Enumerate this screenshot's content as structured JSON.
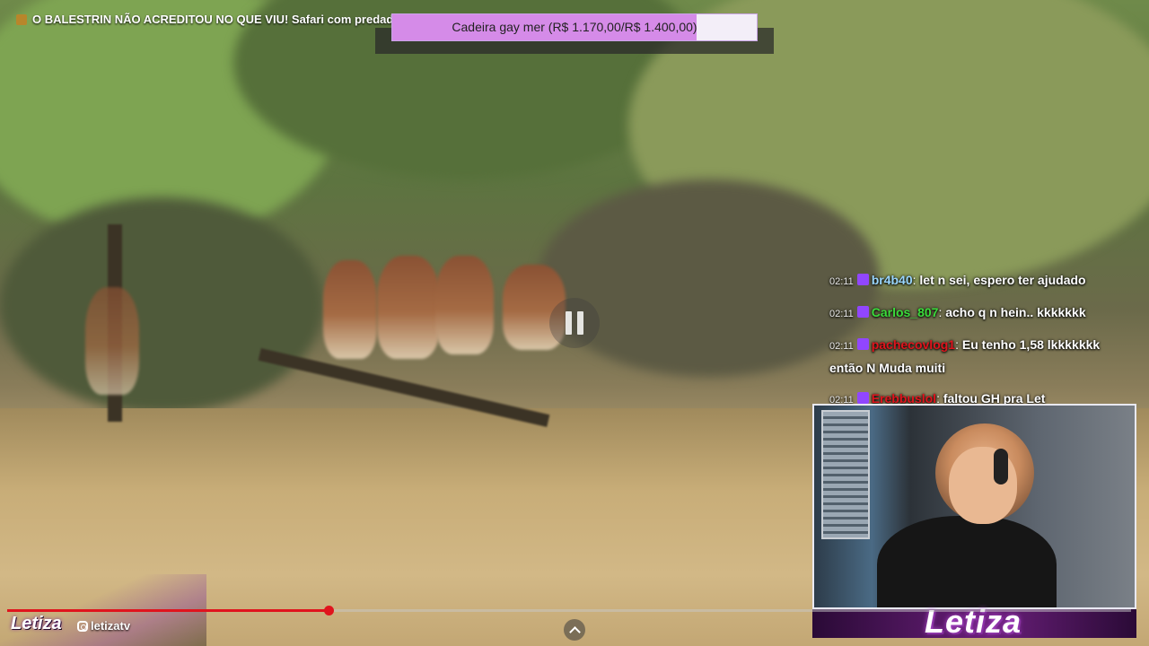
{
  "stream": {
    "title": "O BALESTRIN NÃO ACREDITOU NO QUE VIU! Safari com predadore",
    "progress_percent": 28.6
  },
  "goal": {
    "text": "Cadeira gay mer (R$ 1.170,00/R$ 1.400,00)",
    "current": 1170,
    "target": 1400,
    "fill_color": "#d58be8"
  },
  "chat": {
    "messages": [
      {
        "time": "02:11",
        "user": "br4b40",
        "user_color": "#9ad7ff",
        "text": "let n sei, espero ter ajudado"
      },
      {
        "time": "02:11",
        "user": "Carlos_807",
        "user_color": "#3bdc3b",
        "text": "acho q n hein.. kkkkkkk"
      },
      {
        "time": "02:11",
        "user": "pachecovlog1",
        "user_color": "#e0141d",
        "text": "Eu tenho 1,58 lkkkkkkk então N Muda muiti"
      },
      {
        "time": "02:11",
        "user": "Erebbuslol",
        "user_color": "#e0141d",
        "text": "faltou GH pra Let"
      }
    ]
  },
  "branding": {
    "logo": "Letiza",
    "handle": "letizatv",
    "cam_logo": "Letiza",
    "accent": "#9146ff"
  },
  "icons": {
    "pause": "pause-icon",
    "instagram": "instagram-icon",
    "chevron": "chevron-up-icon",
    "badge": "twitch-badge-icon"
  }
}
